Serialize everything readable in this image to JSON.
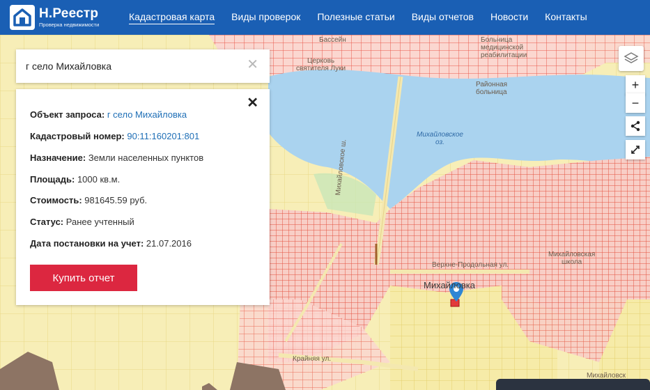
{
  "brand": {
    "title": "Н.Реестр",
    "subtitle": "Проверка недвижимости"
  },
  "nav": {
    "items": [
      {
        "label": "Кадастровая карта"
      },
      {
        "label": "Виды проверок"
      },
      {
        "label": "Полезные статьи"
      },
      {
        "label": "Виды отчетов"
      },
      {
        "label": "Новости"
      },
      {
        "label": "Контакты"
      }
    ]
  },
  "search": {
    "value": "г село Михайловка",
    "clear_icon": "close-icon"
  },
  "card": {
    "close_icon": "close-icon",
    "rows": [
      {
        "label": "Объект запроса:",
        "value": "г село Михайловка"
      },
      {
        "label": "Кадастровый номер:",
        "value": "90:11:160201:801"
      },
      {
        "label": "Назначение:",
        "value": "Земли населенных пунктов"
      },
      {
        "label": "Площадь:",
        "value": "1000 кв.м."
      },
      {
        "label": "Стоимость:",
        "value": "981645.59 руб."
      },
      {
        "label": "Статус:",
        "value": "Ранее учтенный"
      },
      {
        "label": "Дата постановки на учет:",
        "value": "21.07.2016"
      }
    ],
    "buy_label": "Купить отчет"
  },
  "map": {
    "labels": {
      "pool": "Бассейн",
      "church": "Церковь\nсвятителя Луки",
      "hospital1": "Больница\nмедицинской\nреабилитации",
      "hospital2": "Районная\nбольница",
      "lake": "Михайловское\nоз.",
      "road_mikh": "Михайловское ш.",
      "street_verkh": "Верхне-Продольная ул.",
      "village": "Михайловка",
      "school": "Михайловская\nшкола",
      "street_krain": "Крайняя ул.",
      "school2": "Михайловск"
    },
    "controls": {
      "zoom_in": "+",
      "zoom_out": "−",
      "share_icon": "share-icon",
      "fullscreen_icon": "fullscreen-icon",
      "layers_icon": "layers-icon"
    }
  },
  "colors": {
    "header": "#1a5fb4",
    "button": "#dc2740",
    "link": "#1f6fb6",
    "parcel_red": "#e85a4a",
    "parcel_yellow": "#f3e59a",
    "water": "#aad3ef"
  }
}
